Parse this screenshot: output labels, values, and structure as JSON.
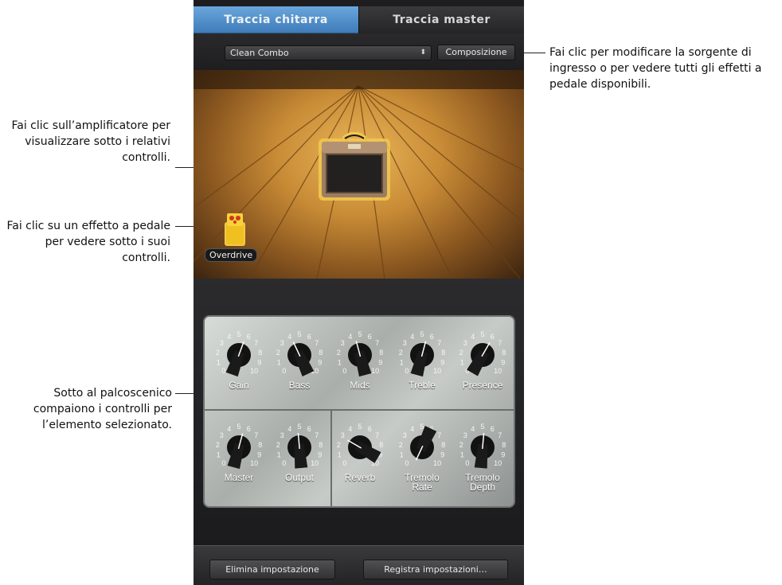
{
  "tabs": {
    "guitar": "Traccia chitarra",
    "master": "Traccia master"
  },
  "preset": {
    "selected": "Clean Combo"
  },
  "compose_button": "Composizione",
  "pedal": {
    "label": "Overdrive"
  },
  "knobs_top": [
    {
      "label": "Gain"
    },
    {
      "label": "Bass"
    },
    {
      "label": "Mids"
    },
    {
      "label": "Treble"
    },
    {
      "label": "Presence"
    }
  ],
  "knobs_bottom": [
    {
      "label": "Master"
    },
    {
      "label": "Output"
    },
    {
      "label": "Reverb"
    },
    {
      "label": "Tremolo\nRate"
    },
    {
      "label": "Tremolo\nDepth"
    }
  ],
  "footer": {
    "delete_label": "Elimina impostazione",
    "save_label": "Registra impostazioni…"
  },
  "callouts": {
    "source": "Fai clic per modificare la sorgente di ingresso o per vedere tutti gli effetti a pedale disponibili.",
    "amp": "Fai clic sull’amplificatore per visualizzare sotto i relativi controlli.",
    "pedal": "Fai clic su un effetto a pedale per vedere sotto i suoi controlli.",
    "stage": "Sotto al palcoscenico compaiono i controlli per l’elemento selezionato."
  },
  "colors": {
    "tab_active": "#4f8cc8",
    "amp_highlight": "#f2c94c",
    "panel": "#1d1d1f"
  }
}
